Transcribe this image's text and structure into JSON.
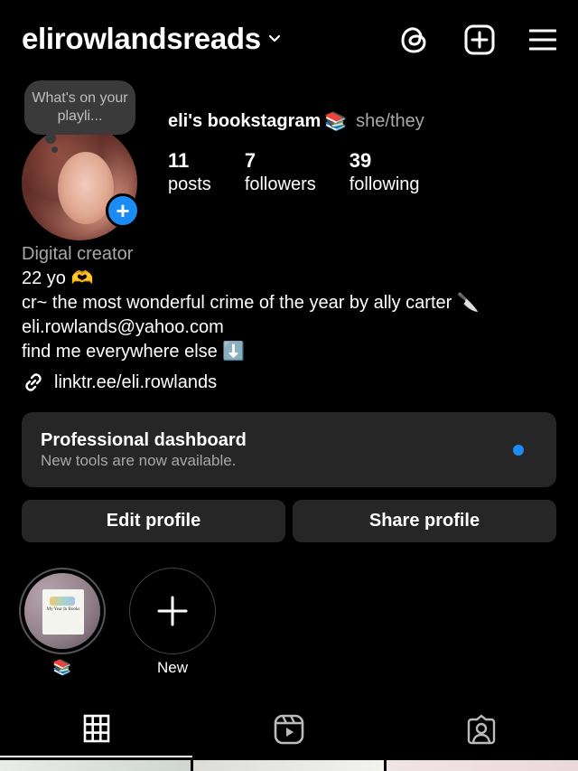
{
  "header": {
    "username": "elirowlandsreads",
    "icons": [
      "threads-icon",
      "create-post-icon",
      "menu-icon"
    ]
  },
  "note": {
    "text": "What's on your playli..."
  },
  "profile": {
    "display_name": "eli's bookstagram",
    "name_emoji": "📚",
    "pronouns": "she/they",
    "stats": [
      {
        "value": "11",
        "label": "posts"
      },
      {
        "value": "7",
        "label": "followers"
      },
      {
        "value": "39",
        "label": "following"
      }
    ]
  },
  "bio": {
    "category": "Digital creator",
    "lines": [
      "22 yo 🫶",
      "cr~ the most wonderful crime of the year by ally carter 🔪",
      "eli.rowlands@yahoo.com",
      "find me everywhere else ⬇️"
    ],
    "link": "linktr.ee/eli.rowlands"
  },
  "dashboard": {
    "title": "Professional dashboard",
    "subtitle": "New tools are now available."
  },
  "buttons": {
    "edit": "Edit profile",
    "share": "Share profile"
  },
  "highlights": [
    {
      "label": "📚",
      "cover_title": "My Year In Books"
    },
    {
      "label": "New"
    }
  ],
  "tabs": [
    "grid-icon",
    "reels-icon",
    "tagged-icon"
  ],
  "colors": {
    "accent": "#1b8cf3",
    "surface": "#262626",
    "muted": "#a8a8a8"
  }
}
